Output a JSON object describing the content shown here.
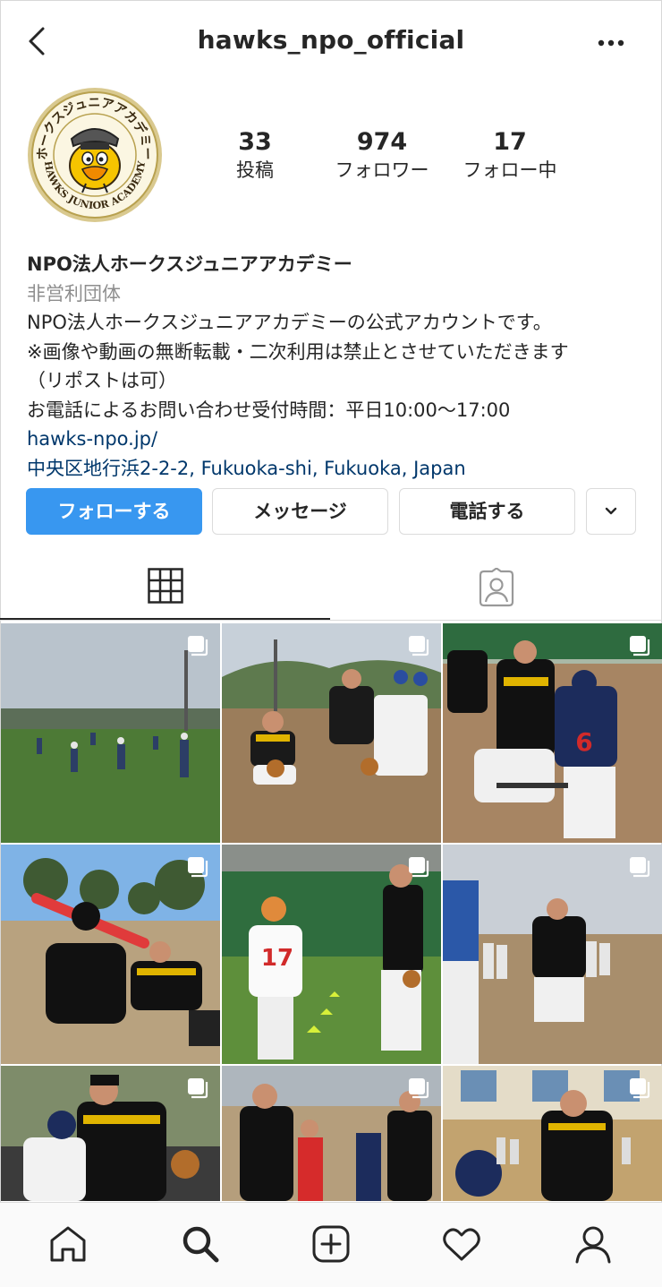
{
  "header": {
    "username": "hawks_npo_official"
  },
  "profile": {
    "avatar_text_top": "ホークスジュニアアカデミー",
    "avatar_text_bottom": "HAWKS JUNIOR ACADEMY",
    "stats": [
      {
        "value": "33",
        "label": "投稿"
      },
      {
        "value": "974",
        "label": "フォロワー"
      },
      {
        "value": "17",
        "label": "フォロー中"
      }
    ],
    "name": "NPO法人ホークスジュニアアカデミー",
    "category": "非営利団体",
    "bio_lines": [
      "NPO法人ホークスジュニアアカデミーの公式アカウントです。",
      "※画像や動画の無断転載・二次利用は禁止とさせていただきます",
      "（リポストは可）",
      "お電話によるお問い合わせ受付時間：平日10:00〜17:00"
    ],
    "website": "hawks-npo.jp/",
    "address": "中央区地行浜2-2-2, Fukuoka-shi, Fukuoka, Japan"
  },
  "actions": {
    "follow": "フォローする",
    "message": "メッセージ",
    "call": "電話する"
  },
  "tabs": {
    "selected": "grid"
  },
  "posts": [
    {
      "scene": "field-kids",
      "jersey": ""
    },
    {
      "scene": "coach-kneel",
      "jersey": ""
    },
    {
      "scene": "coach-pitch",
      "jersey": "6"
    },
    {
      "scene": "batting",
      "jersey": ""
    },
    {
      "scene": "player-17",
      "jersey": "17"
    },
    {
      "scene": "pitching-drill",
      "jersey": ""
    },
    {
      "scene": "coach-glove",
      "jersey": ""
    },
    {
      "scene": "kids-coach",
      "jersey": ""
    },
    {
      "scene": "gym",
      "jersey": ""
    }
  ],
  "colors": {
    "primary": "#3897f0",
    "link": "#00376b",
    "secondary_text": "#8e8e8e",
    "text": "#262626"
  }
}
